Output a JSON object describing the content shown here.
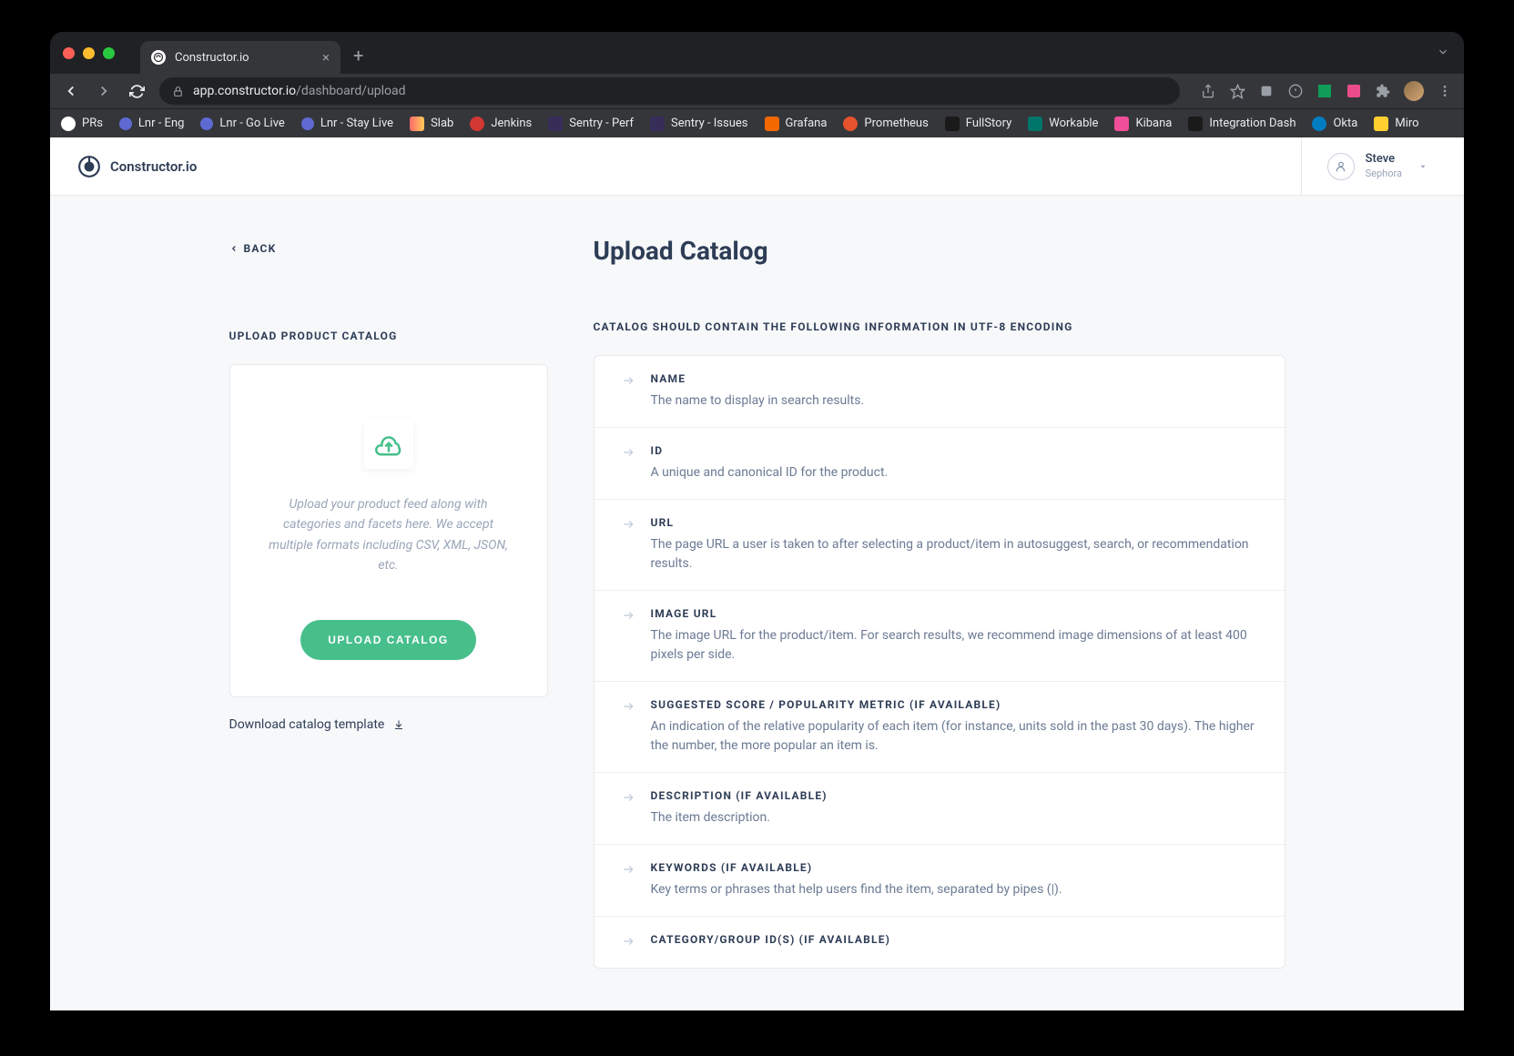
{
  "browser": {
    "tab": {
      "title": "Constructor.io"
    },
    "url": {
      "host": "app.constructor.io",
      "path": "/dashboard/upload"
    },
    "bookmarks": [
      {
        "label": "PRs",
        "iconClass": "bi-github"
      },
      {
        "label": "Lnr - Eng",
        "iconClass": "bi-lnr"
      },
      {
        "label": "Lnr - Go Live",
        "iconClass": "bi-lnr"
      },
      {
        "label": "Lnr - Stay Live",
        "iconClass": "bi-lnr"
      },
      {
        "label": "Slab",
        "iconClass": "bi-slab"
      },
      {
        "label": "Jenkins",
        "iconClass": "bi-jenkins"
      },
      {
        "label": "Sentry - Perf",
        "iconClass": "bi-sentry"
      },
      {
        "label": "Sentry - Issues",
        "iconClass": "bi-sentry"
      },
      {
        "label": "Grafana",
        "iconClass": "bi-grafana"
      },
      {
        "label": "Prometheus",
        "iconClass": "bi-prom"
      },
      {
        "label": "FullStory",
        "iconClass": "bi-fs"
      },
      {
        "label": "Workable",
        "iconClass": "bi-work"
      },
      {
        "label": "Kibana",
        "iconClass": "bi-kibana"
      },
      {
        "label": "Integration Dash",
        "iconClass": "bi-intg"
      },
      {
        "label": "Okta",
        "iconClass": "bi-okta"
      },
      {
        "label": "Miro",
        "iconClass": "bi-miro"
      }
    ]
  },
  "app": {
    "brand": "Constructor.io",
    "user": {
      "name": "Steve",
      "org": "Sephora"
    }
  },
  "page": {
    "back": "BACK",
    "title": "Upload Catalog",
    "left": {
      "heading": "UPLOAD PRODUCT CATALOG",
      "description": "Upload your product feed along with categories and facets here. We accept multiple formats including CSV, XML, JSON, etc.",
      "buttonLabel": "UPLOAD CATALOG",
      "downloadLabel": "Download catalog template"
    },
    "right": {
      "heading": "CATALOG SHOULD CONTAIN THE FOLLOWING INFORMATION IN UTF-8 ENCODING",
      "fields": [
        {
          "name": "NAME",
          "desc": "The name to display in search results."
        },
        {
          "name": "ID",
          "desc": "A unique and canonical ID for the product."
        },
        {
          "name": "URL",
          "desc": "The page URL a user is taken to after selecting a product/item in autosuggest, search, or recommendation results."
        },
        {
          "name": "IMAGE URL",
          "desc": "The image URL for the product/item. For search results, we recommend image dimensions of at least 400 pixels per side."
        },
        {
          "name": "SUGGESTED SCORE / POPULARITY METRIC (IF AVAILABLE)",
          "desc": "An indication of the relative popularity of each item (for instance, units sold in the past 30 days). The higher the number, the more popular an item is."
        },
        {
          "name": "DESCRIPTION (IF AVAILABLE)",
          "desc": "The item description."
        },
        {
          "name": "KEYWORDS (IF AVAILABLE)",
          "desc": "Key terms or phrases that help users find the item, separated by pipes (|)."
        },
        {
          "name": "CATEGORY/GROUP ID(S) (IF AVAILABLE)",
          "desc": ""
        }
      ]
    }
  },
  "colors": {
    "accent": "#47bf8b",
    "textDark": "#2e3d56",
    "textMuted": "#9aa5b8"
  }
}
